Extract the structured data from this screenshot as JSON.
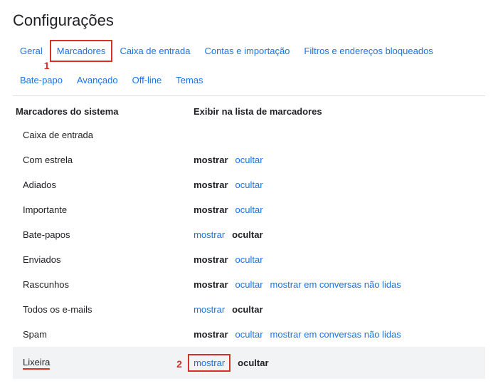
{
  "page_title": "Configurações",
  "tabs_row1": [
    "Geral",
    "Marcadores",
    "Caixa de entrada",
    "Contas e importação",
    "Filtros e endereços bloqueados"
  ],
  "tabs_row2": [
    "Bate-papo",
    "Avançado",
    "Off-line",
    "Temas"
  ],
  "active_tab_index": 1,
  "headers": {
    "labels": "Marcadores do sistema",
    "show": "Exibir na lista de marcadores"
  },
  "annot": {
    "one": "1",
    "two": "2"
  },
  "labels": {
    "mostrar": "mostrar",
    "ocultar": "ocultar",
    "unread": "mostrar em conversas não lidas"
  },
  "rows": [
    {
      "name": "Caixa de entrada"
    },
    {
      "name": "Com estrela"
    },
    {
      "name": "Adiados"
    },
    {
      "name": "Importante"
    },
    {
      "name": "Bate-papos"
    },
    {
      "name": "Enviados"
    },
    {
      "name": "Rascunhos"
    },
    {
      "name": "Todos os e-mails"
    },
    {
      "name": "Spam"
    },
    {
      "name": "Lixeira"
    }
  ]
}
